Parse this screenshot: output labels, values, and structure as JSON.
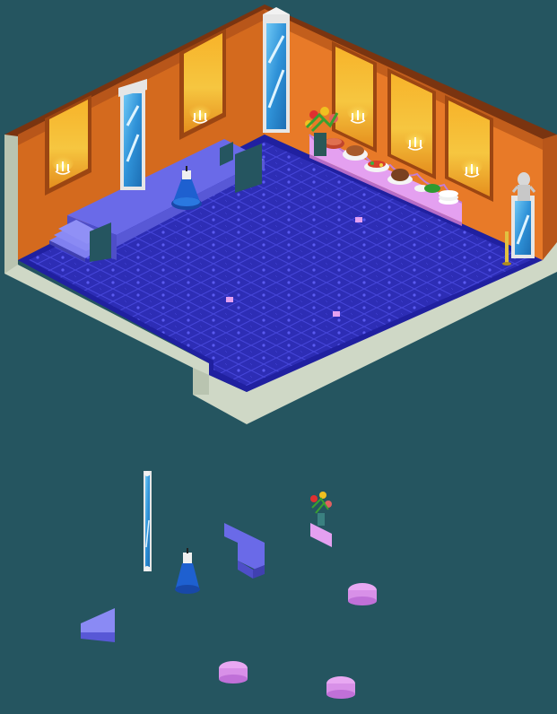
{
  "scene": {
    "background_color": "#255560",
    "room": {
      "wall_colors": {
        "outer": "#E07028",
        "inner": "#C85A18",
        "trim": "#8A3A10",
        "panel": "#F0A020"
      },
      "floor_colors": {
        "carpet": "#2D2DB5",
        "pattern": "#4848E0",
        "border": "#2020A0",
        "base": "#CFD8C6"
      },
      "stage_color": "#6A6AE8"
    },
    "objects": [
      {
        "name": "mirror-pillar-icon",
        "kind": "mirror"
      },
      {
        "name": "blue-candle-icon",
        "kind": "candle"
      },
      {
        "name": "flower-vase-icon",
        "kind": "plant"
      },
      {
        "name": "buffet-table-icon",
        "kind": "table"
      },
      {
        "name": "statue-icon",
        "kind": "statue"
      },
      {
        "name": "sconce-icon",
        "kind": "wall-light"
      }
    ],
    "inventory": [
      {
        "name": "loose-mirror-pillar",
        "kind": "mirror"
      },
      {
        "name": "loose-candle",
        "kind": "candle"
      },
      {
        "name": "loose-flower-table",
        "kind": "plant"
      },
      {
        "name": "loose-stage-corner",
        "kind": "platform"
      },
      {
        "name": "loose-stage-step",
        "kind": "platform"
      },
      {
        "name": "pink-stool-1",
        "kind": "stool"
      },
      {
        "name": "pink-stool-2",
        "kind": "stool"
      },
      {
        "name": "pink-stool-3",
        "kind": "stool"
      }
    ]
  }
}
